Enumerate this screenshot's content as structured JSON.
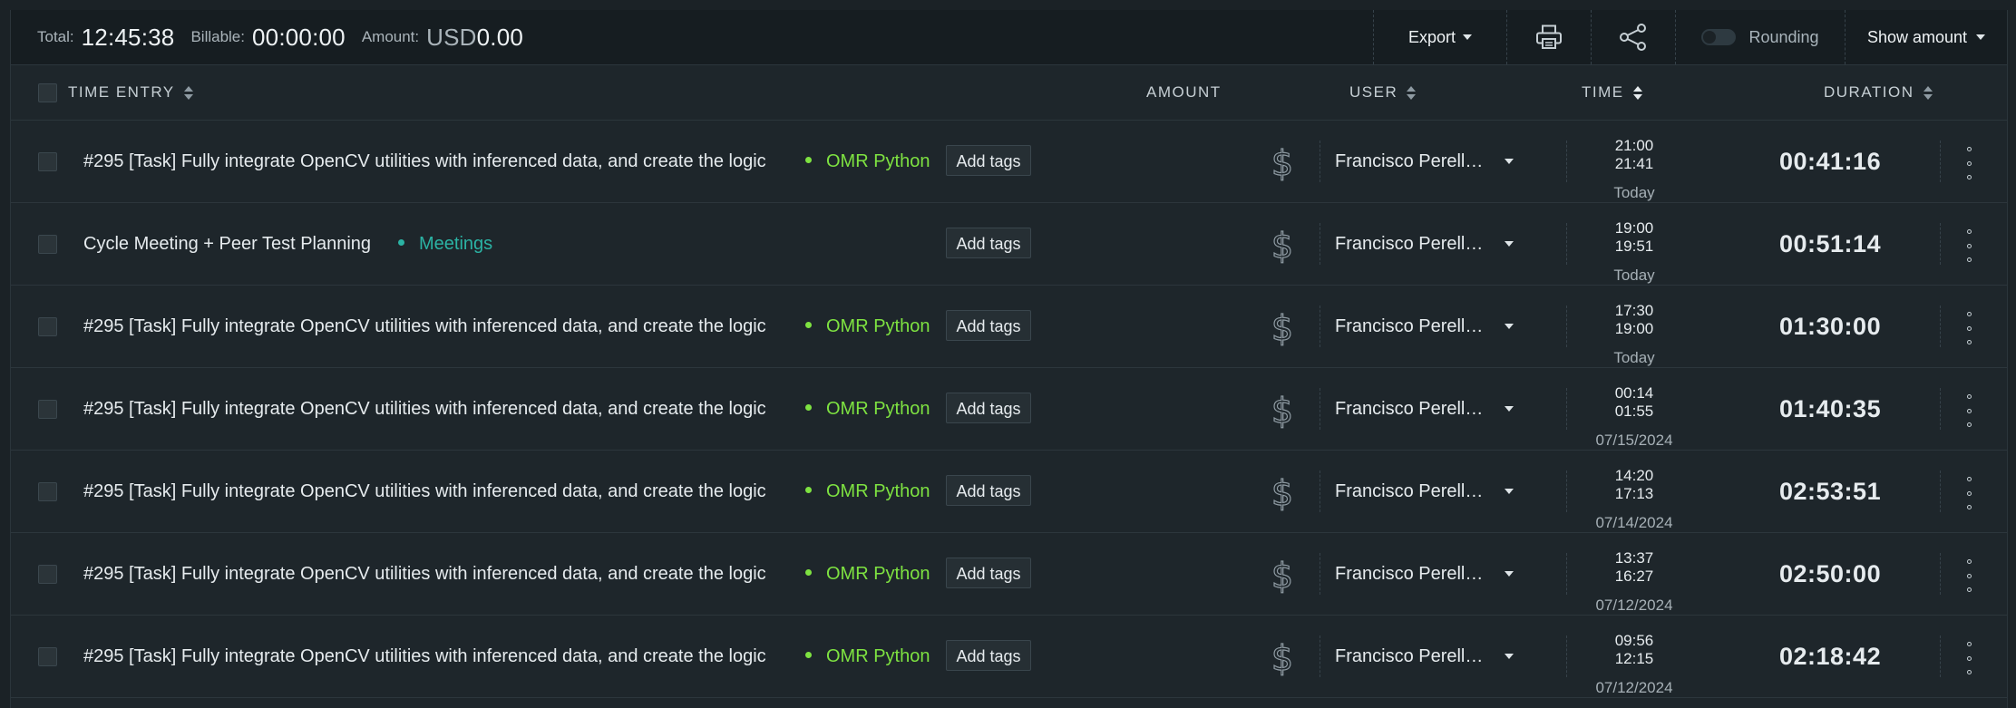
{
  "summary": {
    "total_label": "Total:",
    "total_value": "12:45:38",
    "billable_label": "Billable:",
    "billable_value": "00:00:00",
    "amount_label": "Amount:",
    "amount_currency": "USD",
    "amount_value": "0.00",
    "export_label": "Export",
    "rounding_label": "Rounding",
    "rounding_enabled": false,
    "show_amount_label": "Show amount",
    "print_icon": "printer-icon",
    "share_icon": "share-icon"
  },
  "table": {
    "headers": {
      "time_entry": "TIME ENTRY",
      "amount": "AMOUNT",
      "user": "USER",
      "time": "TIME",
      "duration": "DURATION"
    },
    "rows": [
      {
        "description": "#295 [Task] Fully integrate OpenCV utilities with inferenced data, and create the logic",
        "project": "OMR Python",
        "project_color": "#7ee241",
        "tag_label": "Add tags",
        "user": "Francisco Perellón",
        "start": "21:00",
        "end": "21:41",
        "date": "Today",
        "duration": "00:41:16"
      },
      {
        "description": "Cycle Meeting + Peer Test Planning",
        "project": "Meetings",
        "project_color": "#2bb3a4",
        "tag_label": "Add tags",
        "user": "Francisco Perellón",
        "start": "19:00",
        "end": "19:51",
        "date": "Today",
        "duration": "00:51:14"
      },
      {
        "description": "#295 [Task] Fully integrate OpenCV utilities with inferenced data, and create the logic",
        "project": "OMR Python",
        "project_color": "#7ee241",
        "tag_label": "Add tags",
        "user": "Francisco Perellón",
        "start": "17:30",
        "end": "19:00",
        "date": "Today",
        "duration": "01:30:00"
      },
      {
        "description": "#295 [Task] Fully integrate OpenCV utilities with inferenced data, and create the logic",
        "project": "OMR Python",
        "project_color": "#7ee241",
        "tag_label": "Add tags",
        "user": "Francisco Perellón",
        "start": "00:14",
        "end": "01:55",
        "date": "07/15/2024",
        "duration": "01:40:35"
      },
      {
        "description": "#295 [Task] Fully integrate OpenCV utilities with inferenced data, and create the logic",
        "project": "OMR Python",
        "project_color": "#7ee241",
        "tag_label": "Add tags",
        "user": "Francisco Perellón",
        "start": "14:20",
        "end": "17:13",
        "date": "07/14/2024",
        "duration": "02:53:51"
      },
      {
        "description": "#295 [Task] Fully integrate OpenCV utilities with inferenced data, and create the logic",
        "project": "OMR Python",
        "project_color": "#7ee241",
        "tag_label": "Add tags",
        "user": "Francisco Perellón",
        "start": "13:37",
        "end": "16:27",
        "date": "07/12/2024",
        "duration": "02:50:00"
      },
      {
        "description": "#295 [Task] Fully integrate OpenCV utilities with inferenced data, and create the logic",
        "project": "OMR Python",
        "project_color": "#7ee241",
        "tag_label": "Add tags",
        "user": "Francisco Perellón",
        "start": "09:56",
        "end": "12:15",
        "date": "07/12/2024",
        "duration": "02:18:42"
      }
    ]
  }
}
